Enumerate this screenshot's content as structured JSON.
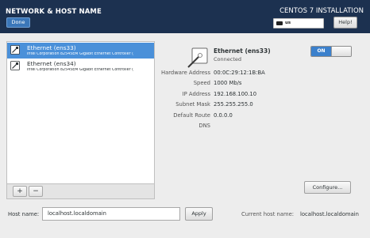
{
  "header": {
    "title": "NETWORK & HOST NAME",
    "done_label": "Done",
    "product": "CENTOS 7 INSTALLATION",
    "keyboard_layout": "us",
    "help_label": "Help!",
    "bg_color": "#1c3150"
  },
  "devices": [
    {
      "name": "Ethernet (ens33)",
      "description": "Intel Corporation 82545EM Gigabit Ethernet Controller (",
      "selected": true
    },
    {
      "name": "Ethernet (ens34)",
      "description": "Intel Corporation 82545EM Gigabit Ethernet Controller (",
      "selected": false
    }
  ],
  "list_toolbar": {
    "add_label": "+",
    "remove_label": "−"
  },
  "detail": {
    "name": "Ethernet (ens33)",
    "status": "Connected",
    "toggle_label": "ON",
    "toggle_on": true,
    "properties": [
      {
        "label": "Hardware Address",
        "value": "00:0C:29:12:1B:BA"
      },
      {
        "label": "Speed",
        "value": "1000 Mb/s"
      },
      {
        "label": "IP Address",
        "value": "192.168.100.10"
      },
      {
        "label": "Subnet Mask",
        "value": "255.255.255.0"
      },
      {
        "label": "Default Route",
        "value": "0.0.0.0"
      },
      {
        "label": "DNS",
        "value": ""
      }
    ],
    "configure_label": "Configure..."
  },
  "hostname": {
    "label": "Host name:",
    "value": "localhost.localdomain",
    "apply_label": "Apply",
    "current_label": "Current host name:",
    "current_value": "localhost.localdomain"
  },
  "colors": {
    "accent": "#3b80cc",
    "selection": "#4a90d9"
  }
}
